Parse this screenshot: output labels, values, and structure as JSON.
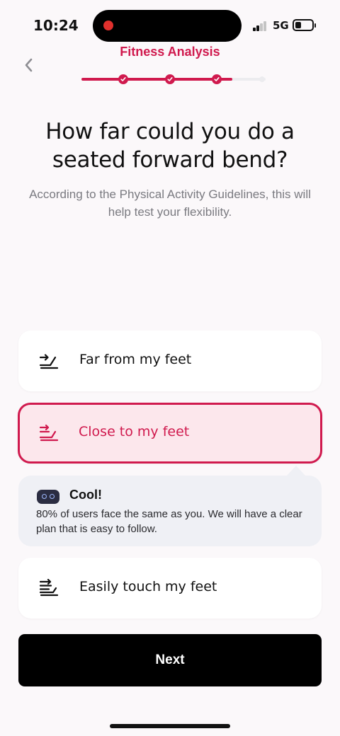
{
  "status_bar": {
    "time": "10:24",
    "network": "5G"
  },
  "header": {
    "title": "Fitness Analysis",
    "progress": {
      "completed_steps": 3,
      "total_steps": 4,
      "fraction": 0.82
    }
  },
  "question": {
    "title": "How far could you do a seated forward bend?",
    "subtitle": "According to the Physical Activity Guidelines, this will help test your flexibility."
  },
  "options": [
    {
      "label": "Far from my feet",
      "icon": "seated-bend-far-icon",
      "selected": false
    },
    {
      "label": "Close to my feet",
      "icon": "seated-bend-close-icon",
      "selected": true
    },
    {
      "label": "Easily touch my feet",
      "icon": "seated-bend-touch-icon",
      "selected": false
    }
  ],
  "feedback": {
    "icon": "robot-icon",
    "title": "Cool!",
    "text": "80% of users face the same as you. We will have a clear plan that is easy to follow."
  },
  "next_button": {
    "label": "Next"
  },
  "colors": {
    "accent": "#d01a4e",
    "selected_background": "#fce7ec",
    "feedback_background": "#eff0f5",
    "button_background": "#000000"
  }
}
